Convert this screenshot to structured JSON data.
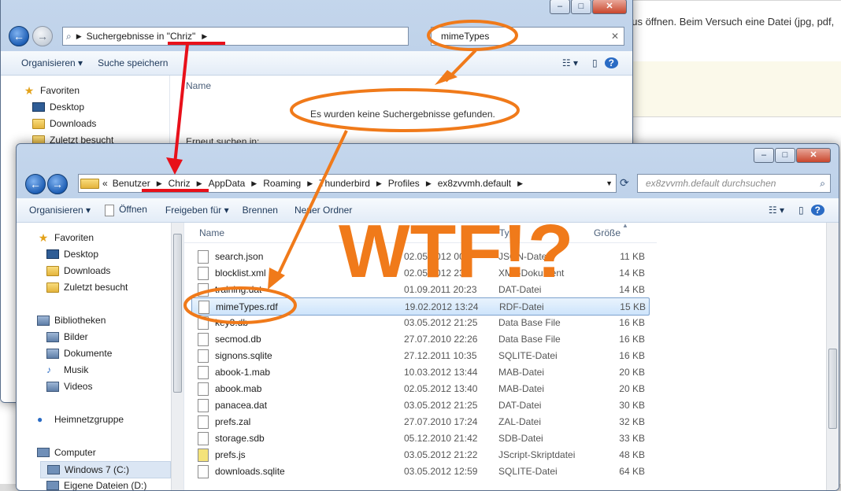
{
  "background_page": {
    "text": "aus öffnen. Beim Versuch eine Datei (jpg, pdf,"
  },
  "search_window": {
    "path": [
      "Suchergebnisse in \"Chriz\""
    ],
    "search_value": "mimeTypes",
    "toolbar": {
      "organize": "Organisieren",
      "save_search": "Suche speichern"
    },
    "nav": [
      "Favoriten",
      "Desktop",
      "Downloads",
      "Zuletzt besucht"
    ],
    "column_name": "Name",
    "no_results": "Es wurden keine Suchergebnisse gefunden.",
    "search_again": "Erneut suchen in:"
  },
  "explorer_window": {
    "path_prefix": "«",
    "path": [
      "Benutzer",
      "Chriz",
      "AppData",
      "Roaming",
      "Thunderbird",
      "Profiles",
      "ex8zvvmh.default"
    ],
    "search_placeholder": "ex8zvvmh.default durchsuchen",
    "toolbar": {
      "organize": "Organisieren",
      "open": "Öffnen",
      "share": "Freigeben für",
      "burn": "Brennen",
      "new_folder": "Neuer Ordner"
    },
    "nav": {
      "favorites": "Favoriten",
      "desktop": "Desktop",
      "downloads": "Downloads",
      "recent": "Zuletzt besucht",
      "libraries": "Bibliotheken",
      "pictures": "Bilder",
      "documents": "Dokumente",
      "music": "Musik",
      "videos": "Videos",
      "homegroup": "Heimnetzgruppe",
      "computer": "Computer",
      "drive_c": "Windows 7 (C:)",
      "drive_d": "Eigene Dateien (D:)"
    },
    "columns": {
      "name": "Name",
      "type": "Typ",
      "size": "Größe"
    },
    "files": [
      {
        "name": "search.json",
        "date": "02.05.2012 00:1",
        "type": "JSON-Datei",
        "size": "11 KB"
      },
      {
        "name": "blocklist.xml",
        "date": "02.05.2012 23:2",
        "type": "XML-Dokument",
        "size": "14 KB"
      },
      {
        "name": "training.dat",
        "date": "01.09.2011 20:23",
        "type": "DAT-Datei",
        "size": "14 KB"
      },
      {
        "name": "mimeTypes.rdf",
        "date": "19.02.2012 13:24",
        "type": "RDF-Datei",
        "size": "15 KB"
      },
      {
        "name": "key3.db",
        "date": "03.05.2012 21:25",
        "type": "Data Base File",
        "size": "16 KB"
      },
      {
        "name": "secmod.db",
        "date": "27.07.2010 22:26",
        "type": "Data Base File",
        "size": "16 KB"
      },
      {
        "name": "signons.sqlite",
        "date": "27.12.2011 10:35",
        "type": "SQLITE-Datei",
        "size": "16 KB"
      },
      {
        "name": "abook-1.mab",
        "date": "10.03.2012 13:44",
        "type": "MAB-Datei",
        "size": "20 KB"
      },
      {
        "name": "abook.mab",
        "date": "02.05.2012 13:40",
        "type": "MAB-Datei",
        "size": "20 KB"
      },
      {
        "name": "panacea.dat",
        "date": "03.05.2012 21:25",
        "type": "DAT-Datei",
        "size": "30 KB"
      },
      {
        "name": "prefs.zal",
        "date": "27.07.2010 17:24",
        "type": "ZAL-Datei",
        "size": "32 KB"
      },
      {
        "name": "storage.sdb",
        "date": "05.12.2010 21:42",
        "type": "SDB-Datei",
        "size": "33 KB"
      },
      {
        "name": "prefs.js",
        "date": "03.05.2012 21:22",
        "type": "JScript-Skriptdatei",
        "size": "48 KB"
      },
      {
        "name": "downloads.sqlite",
        "date": "03.05.2012 12:59",
        "type": "SQLITE-Datei",
        "size": "64 KB"
      }
    ]
  },
  "annotation": {
    "wtf": "WTF!?",
    "color": "#f07a1a",
    "red": "#e8101a"
  }
}
